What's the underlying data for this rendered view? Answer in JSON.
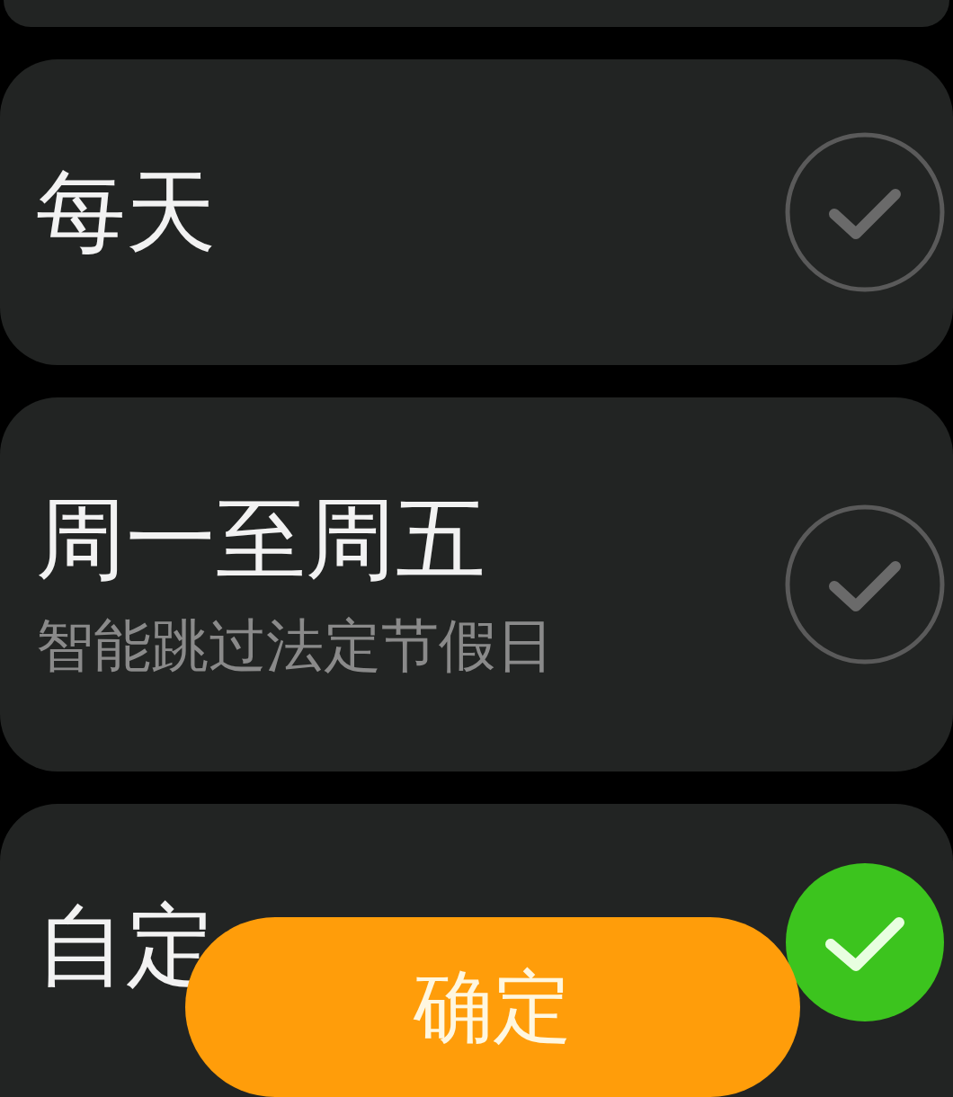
{
  "options": [
    {
      "title": "每天",
      "selected": false
    },
    {
      "title": "周一至周五",
      "subtitle": "智能跳过法定节假日",
      "selected": false
    },
    {
      "title": "自定",
      "selected": true
    }
  ],
  "confirm_button": {
    "label": "确定"
  }
}
